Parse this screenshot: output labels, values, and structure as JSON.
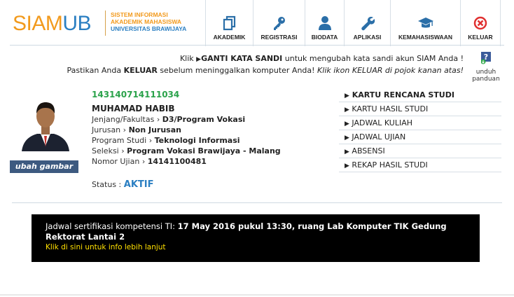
{
  "logo": {
    "siam": "SIAM",
    "ub": "UB",
    "line1": "SISTEM INFORMASI",
    "line2": "AKADEMIK MAHASISWA",
    "line3": "UNIVERSITAS BRAWIJAYA"
  },
  "nav": [
    {
      "label": "AKADEMIK",
      "icon": "document-icon"
    },
    {
      "label": "REGISTRASI",
      "icon": "key-icon"
    },
    {
      "label": "BIODATA",
      "icon": "user-icon"
    },
    {
      "label": "APLIKASI",
      "icon": "wrench-icon"
    },
    {
      "label": "KEMAHASISWAAN",
      "icon": "graduation-cap-icon"
    },
    {
      "label": "KELUAR",
      "icon": "close-circle-icon"
    }
  ],
  "notice": {
    "line1_pre": "Klik ",
    "line1_link": "GANTI KATA SANDI",
    "line1_post": " untuk mengubah kata sandi akun SIAM Anda !",
    "line2_pre": "Pastikan Anda ",
    "line2_bold": "KELUAR",
    "line2_mid": " sebelum meninggalkan komputer Anda! ",
    "line2_italic": "Klik ikon KELUAR di pojok kanan atas!"
  },
  "guide": {
    "label1": "unduh",
    "label2": "panduan"
  },
  "profile": {
    "change_photo": "ubah gambar",
    "nim": "143140714111034",
    "name": "MUHAMAD HABIB",
    "rows": [
      {
        "label": "Jenjang/Fakultas",
        "value": "D3/Program Vokasi"
      },
      {
        "label": "Jurusan",
        "value": "Non Jurusan"
      },
      {
        "label": "Program Studi",
        "value": "Teknologi Informasi"
      },
      {
        "label": "Seleksi",
        "value": "Program Vokasi Brawijaya - Malang"
      },
      {
        "label": "Nomor Ujian",
        "value": "14141100481"
      }
    ],
    "status_label": "Status : ",
    "status_value": "AKTIF"
  },
  "menu": [
    {
      "label": "KARTU RENCANA STUDI"
    },
    {
      "label": "KARTU HASIL STUDI"
    },
    {
      "label": "JADWAL KULIAH"
    },
    {
      "label": "JADWAL UJIAN"
    },
    {
      "label": "ABSENSI"
    },
    {
      "label": "REKAP HASIL STUDI"
    }
  ],
  "announcement": {
    "prefix": "Jadwal sertifikasi kompetensi TI: ",
    "bold": "17 May 2016 pukul 13:30, ruang Lab Komputer TIK Gedung Rektorat Lantai 2",
    "link": "Klik di sini untuk info lebih lanjut"
  },
  "colors": {
    "brand_orange": "#f29a1d",
    "brand_blue": "#2b7fc2",
    "nim_green": "#2aa24a",
    "icon_blue": "#2b6fa8",
    "exit_red": "#e03030",
    "announcement_link": "#ffe000"
  }
}
